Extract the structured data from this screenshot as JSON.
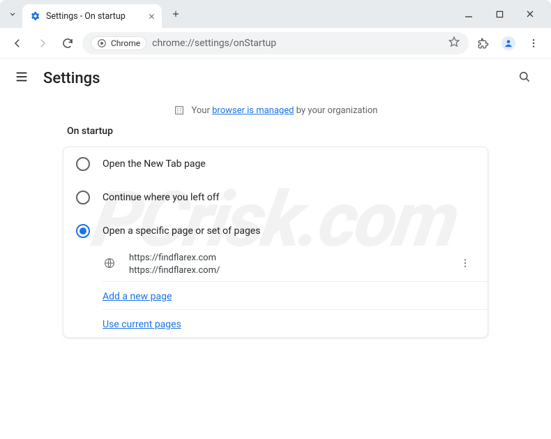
{
  "window": {
    "tab_title": "Settings - On startup",
    "new_tab_tooltip": "New tab"
  },
  "toolbar": {
    "chrome_chip": "Chrome",
    "url": "chrome://settings/onStartup"
  },
  "header": {
    "title": "Settings"
  },
  "managed": {
    "prefix": "Your ",
    "link": "browser is managed",
    "suffix": " by your organization"
  },
  "section": {
    "title": "On startup",
    "options": [
      {
        "label": "Open the New Tab page",
        "selected": false
      },
      {
        "label": "Continue where you left off",
        "selected": false
      },
      {
        "label": "Open a specific page or set of pages",
        "selected": true
      }
    ],
    "page_entry": {
      "line1": "https://findflarex.com",
      "line2": "https://findflarex.com/"
    },
    "add_link": "Add a new page",
    "use_current_link": "Use current pages"
  },
  "watermark": "PCrisk.com"
}
